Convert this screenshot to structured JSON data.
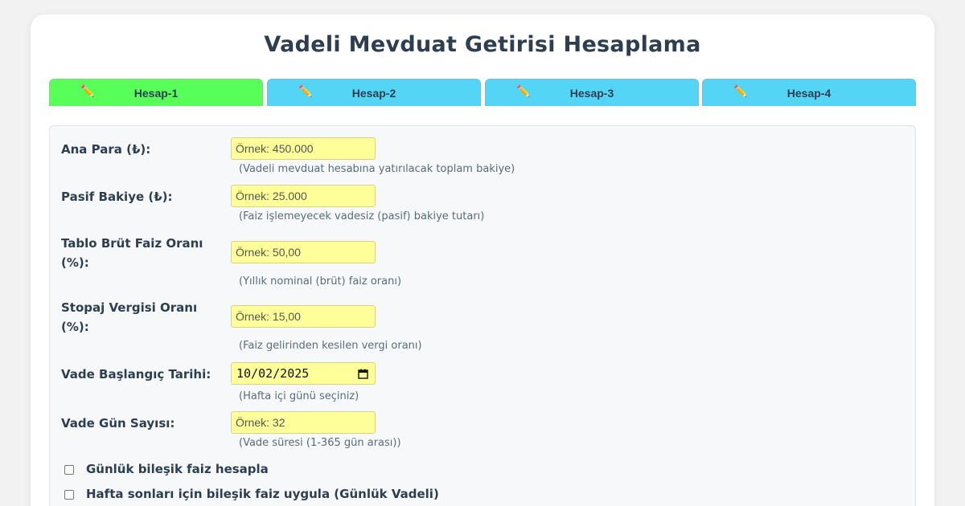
{
  "page": {
    "title": "Vadeli Mevduat Getirisi Hesaplama"
  },
  "tabs": [
    {
      "label": "Hesap-1",
      "icon": "pencil-icon",
      "active": true,
      "color": "#59ff59"
    },
    {
      "label": "Hesap-2",
      "icon": "pencil-icon",
      "active": false,
      "color": "#55d5f5"
    },
    {
      "label": "Hesap-3",
      "icon": "pencil-icon",
      "active": false,
      "color": "#55d5f5"
    },
    {
      "label": "Hesap-4",
      "icon": "pencil-icon",
      "active": false,
      "color": "#55d5f5"
    }
  ],
  "form": {
    "principal": {
      "label": "Ana Para (₺):",
      "placeholder": "Örnek: 450.000",
      "hint": "(Vadeli mevduat hesabına yatırılacak toplam bakiye)"
    },
    "passive_balance": {
      "label": "Pasif Bakiye (₺):",
      "placeholder": "Örnek: 25.000",
      "hint": "(Faiz işlemeyecek vadesiz (pasif) bakiye tutarı)"
    },
    "gross_rate": {
      "label": "Tablo Brüt Faiz Oranı (%):",
      "placeholder": "Örnek: 50,00",
      "hint": "(Yıllık nominal (brüt) faiz oranı)"
    },
    "withholding_rate": {
      "label": "Stopaj Vergisi Oranı (%):",
      "placeholder": "Örnek: 15,00",
      "hint": "(Faiz gelirinden kesilen vergi oranı)"
    },
    "start_date": {
      "label": "Vade Başlangıç Tarihi:",
      "value": "10/02/2025",
      "hint": "(Hafta içi günü seçiniz)"
    },
    "term_days": {
      "label": "Vade Gün Sayısı:",
      "placeholder": "Örnek: 32",
      "hint": "(Vade süresi (1-365 gün arası))"
    },
    "checkboxes": [
      {
        "label": "Günlük bileşik faiz hesapla",
        "checked": false
      },
      {
        "label": "Hafta sonları için bileşik faiz uygula (Günlük Vadeli)",
        "checked": false
      }
    ]
  },
  "colors": {
    "input_bg": "#ffff99",
    "active_tab": "#59ff59",
    "inactive_tab": "#55d5f5",
    "title": "#2c3e50"
  }
}
